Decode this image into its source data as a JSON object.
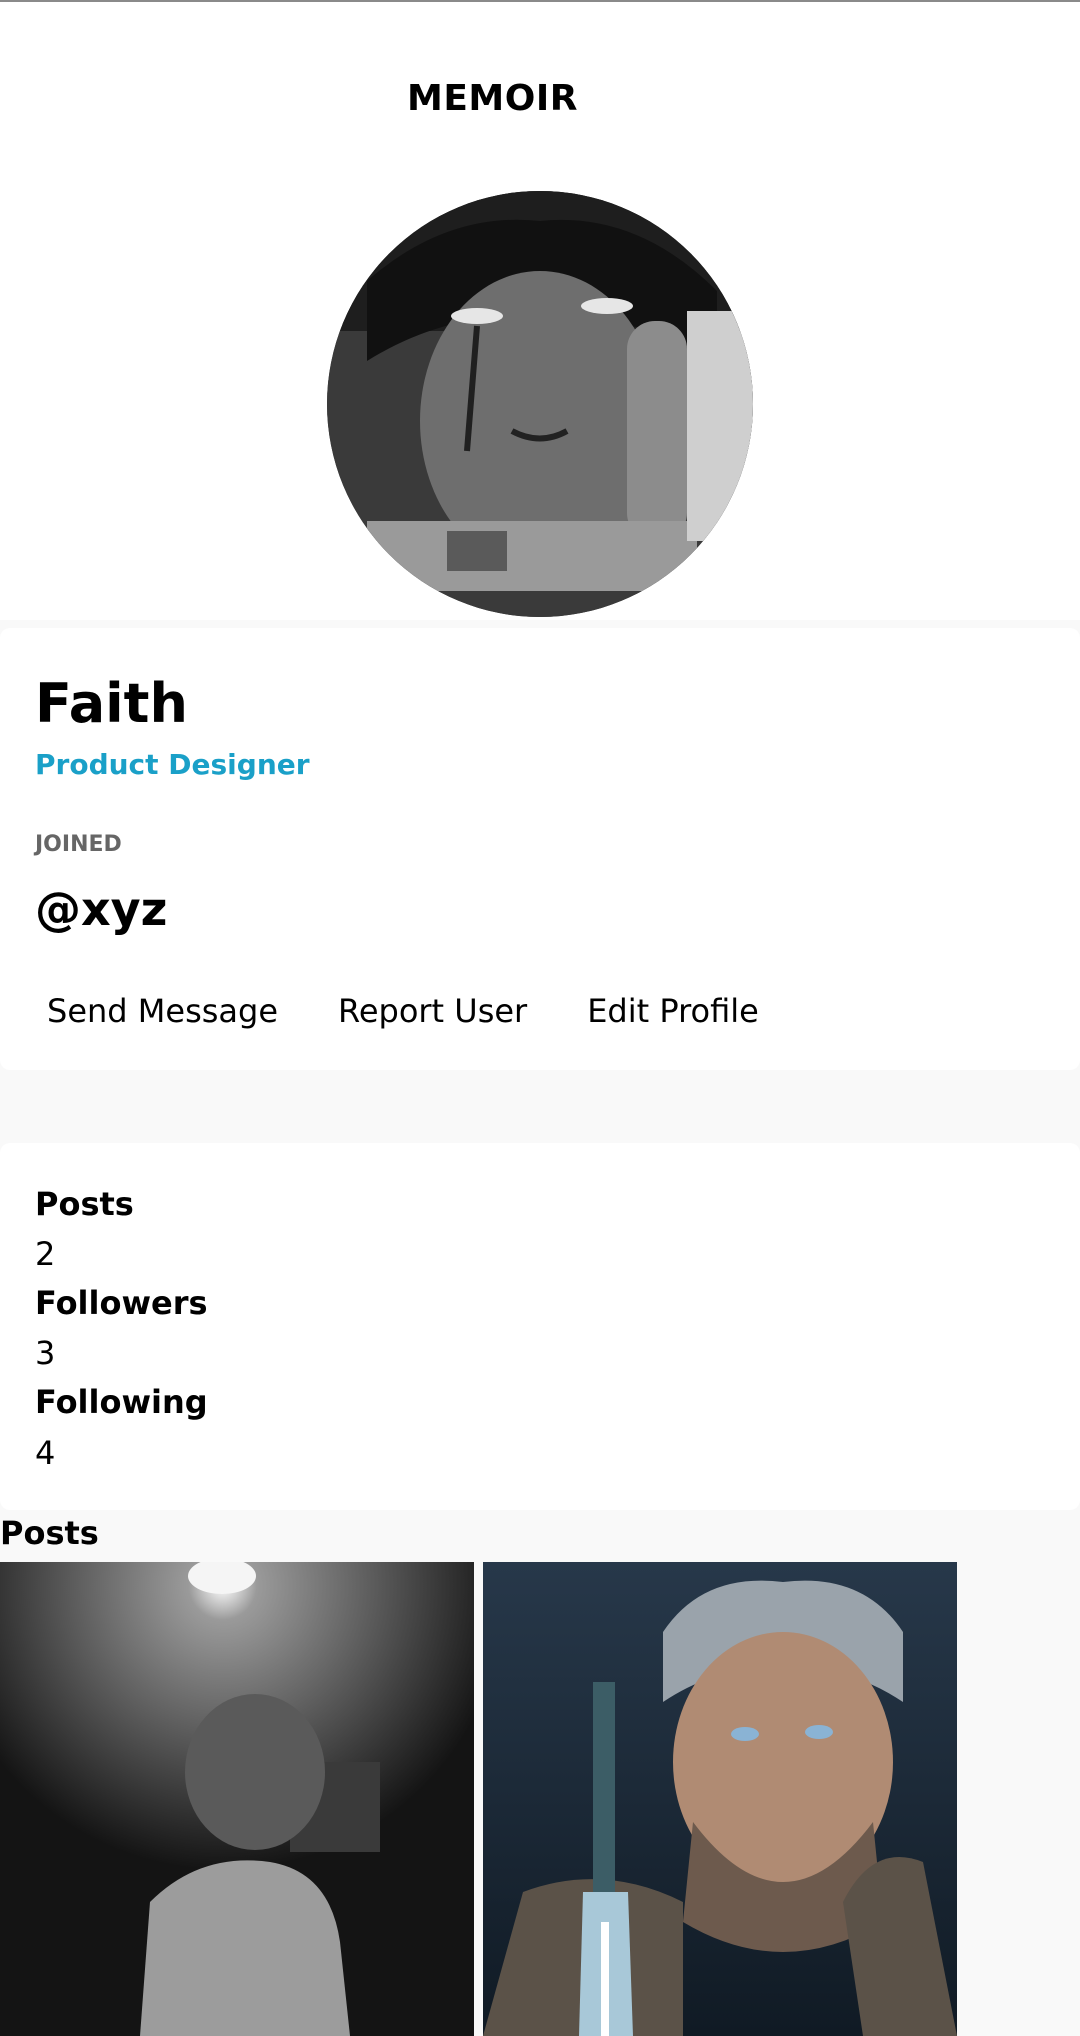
{
  "app": {
    "brand": "MEMOIR"
  },
  "profile": {
    "name": "Faith",
    "role": "Product Designer",
    "joined_label": "JOINED",
    "handle": "@xyz",
    "actions": {
      "send_message": "Send Message",
      "report_user": "Report User",
      "edit_profile": "Edit Profile"
    }
  },
  "stats": {
    "posts_label": "Posts",
    "posts_value": "2",
    "followers_label": "Followers",
    "followers_value": "3",
    "following_label": "Following",
    "following_value": "4"
  },
  "posts_section": {
    "title": "Posts"
  },
  "colors": {
    "accent": "#1aa0c8",
    "muted": "#666666",
    "background": "#f9f9f9",
    "card": "#ffffff"
  }
}
